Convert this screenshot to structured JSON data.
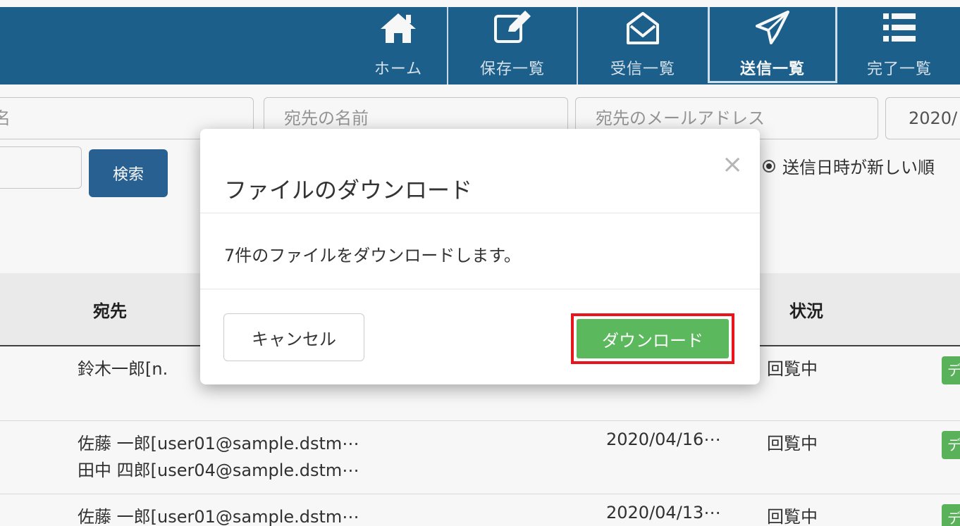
{
  "nav": {
    "items": [
      {
        "label": "ホーム",
        "icon": "home-icon"
      },
      {
        "label": "保存一覧",
        "icon": "edit-icon"
      },
      {
        "label": "受信一覧",
        "icon": "envelope-open-icon"
      },
      {
        "label": "送信一覧",
        "icon": "paper-plane-icon",
        "active": true
      },
      {
        "label": "完了一覧",
        "icon": "list-icon"
      }
    ],
    "bg_color": "#1e6390"
  },
  "search": {
    "field_partial_label": "名",
    "recipient_name_placeholder": "宛先の名前",
    "recipient_email_placeholder": "宛先のメールアドレス",
    "date_value": "2020/",
    "search_button": "検索",
    "sort_radio_label": "送信日時が新しい順"
  },
  "table": {
    "headers": {
      "recipient": "宛先",
      "status": "状況"
    },
    "rows": [
      {
        "recipient_lines": [
          "鈴木一郎[n."
        ],
        "date": "",
        "status": "回覧中",
        "tag": "デ"
      },
      {
        "recipient_lines": [
          "佐藤 一郎[user01@sample.dstm⋯",
          "田中 四郎[user04@sample.dstm⋯"
        ],
        "date": "2020/04/16⋯",
        "status": "回覧中",
        "tag": "デ"
      },
      {
        "recipient_lines": [
          "佐藤 一郎[user01@sample.dstm⋯"
        ],
        "date": "2020/04/13⋯",
        "status": "回覧中",
        "tag": "デ"
      }
    ]
  },
  "modal": {
    "title": "ファイルのダウンロード",
    "close": "×",
    "message": "7件のファイルをダウンロードします。",
    "cancel_label": "キャンセル",
    "download_label": "ダウンロード",
    "highlight_color": "#e8151c",
    "download_color": "#5cb85c"
  }
}
